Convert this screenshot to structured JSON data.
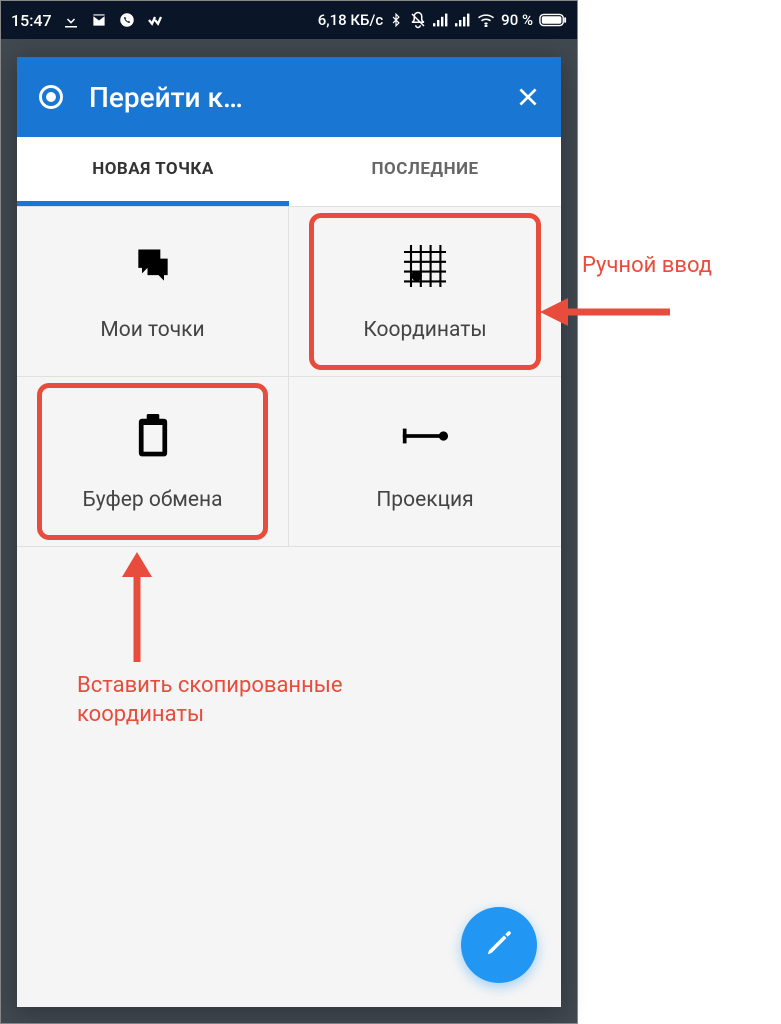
{
  "status": {
    "time": "15:47",
    "speed": "6,18 КБ/с",
    "battery": "90 %"
  },
  "dialog": {
    "title": "Перейти к…",
    "tabs": [
      {
        "label": "НОВАЯ ТОЧКА",
        "active": true
      },
      {
        "label": "ПОСЛЕДНИЕ",
        "active": false
      }
    ],
    "tiles": [
      {
        "label": "Мои точки",
        "icon": "chat-icon"
      },
      {
        "label": "Координаты",
        "icon": "grid-icon"
      },
      {
        "label": "Буфер обмена",
        "icon": "clipboard-icon"
      },
      {
        "label": "Проекция",
        "icon": "projection-icon"
      }
    ]
  },
  "annotations": {
    "coordinates": "Ручной ввод",
    "clipboard": "Вставить скопированные координаты"
  }
}
